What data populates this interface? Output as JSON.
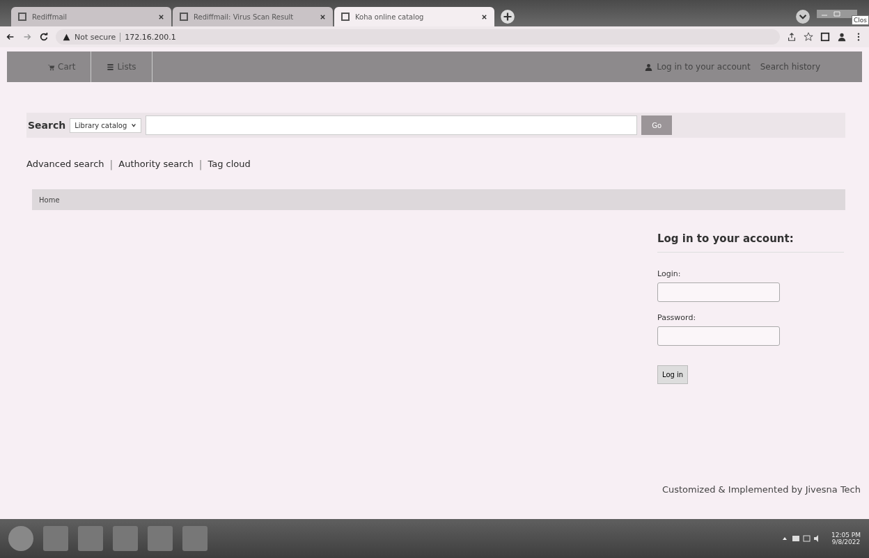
{
  "browser": {
    "tabs": [
      {
        "title": "Rediffmail",
        "selected": false
      },
      {
        "title": "Rediffmail: Virus Scan Result",
        "selected": false
      },
      {
        "title": "Koha online catalog",
        "selected": true
      }
    ],
    "security": "Not secure",
    "url": "172.16.200.1",
    "tooltip": "Clos"
  },
  "navbar": {
    "left": [
      {
        "label": "Cart",
        "kind": "cart"
      },
      {
        "label": "Lists",
        "kind": "lists"
      }
    ],
    "login": "Log in to your account",
    "history": "Search history"
  },
  "search": {
    "label": "Search",
    "scope": "Library catalog",
    "button": "Go"
  },
  "links": [
    {
      "kind": "link",
      "text": "Advanced search"
    },
    {
      "kind": "separator",
      "text": "|"
    },
    {
      "kind": "link",
      "text": "Authority search"
    },
    {
      "kind": "separator",
      "text": "|"
    },
    {
      "kind": "link",
      "text": "Tag cloud"
    }
  ],
  "breadcrumb": "Home",
  "login": {
    "title": "Log in to your account:",
    "fields": [
      {
        "label": "Login:"
      },
      {
        "label": "Password:"
      }
    ],
    "button": "Log in"
  },
  "footer": "Customized & Implemented by Jivesna Tech",
  "taskbar": {
    "time": "12:05 PM",
    "date": "9/8/2022"
  }
}
